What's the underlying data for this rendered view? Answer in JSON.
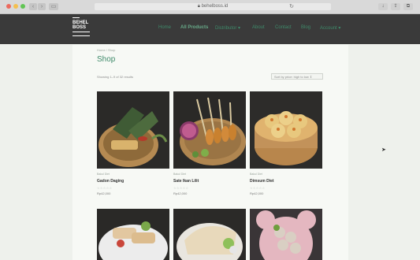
{
  "browser": {
    "url": "behelboss.id",
    "colors": {
      "close": "#ec6a5e",
      "minimize": "#f4bf4f",
      "maximize": "#61c554"
    }
  },
  "header": {
    "logo_brand": "BEHEL\nBOSS",
    "nav": [
      {
        "label": "Home"
      },
      {
        "label": "All Products"
      },
      {
        "label": "Distributor ▾"
      },
      {
        "label": "About"
      },
      {
        "label": "Contact"
      },
      {
        "label": "Blog"
      },
      {
        "label": "Account ▾"
      }
    ]
  },
  "shop": {
    "breadcrumb": "Home / Shop",
    "title": "Shop",
    "result_count": "Showing 1–9 of 32 results",
    "sort_label": "Sort by price: high to low ⇕"
  },
  "products": [
    {
      "category": "Bakul Diet",
      "title": "Gadon Daging",
      "stars": "☆☆☆☆☆",
      "price": "Rp42,000"
    },
    {
      "category": "Bakul Diet",
      "title": "Sate Ikan Lilit",
      "stars": "☆☆☆☆☆",
      "price": "Rp42,000"
    },
    {
      "category": "Bakul Diet",
      "title": "Dimsum Diet",
      "stars": "☆☆☆☆☆",
      "price": "Rp42,000"
    }
  ],
  "accent_color": "#3f8a6a"
}
